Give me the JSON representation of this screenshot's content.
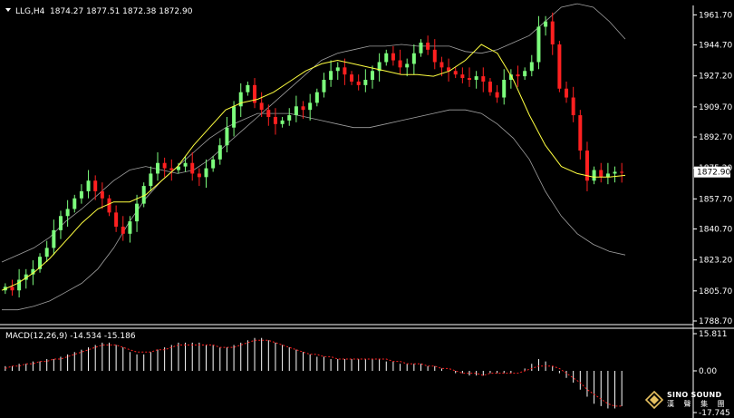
{
  "header": {
    "symbol": "LLG,H4",
    "ohlc": "1874.27 1877.51 1872.38 1872.90"
  },
  "macd_label": "MACD(12,26,9) -14.534 -15.186",
  "price_axis": {
    "ticks": [
      "1961.70",
      "1944.70",
      "1927.20",
      "1909.70",
      "1892.70",
      "1875.20",
      "1857.70",
      "1840.70",
      "1823.20",
      "1805.70",
      "1788.70"
    ],
    "current_price": "1872.90"
  },
  "macd_axis": {
    "ticks": [
      "15.811",
      "0.00",
      "-17.745"
    ]
  },
  "logo": {
    "en": "SINO SOUND",
    "cn": "漢 聲 集 團"
  },
  "colors": {
    "background": "#000000",
    "bull": "#7CFC7C",
    "bear": "#FF2020",
    "ma": "#FFFF40",
    "bands": "#A0A0A0",
    "macd_hist": "#FFFFFF",
    "macd_signal": "#FF2020"
  },
  "chart_data": [
    {
      "type": "candlestick",
      "title": "LLG,H4",
      "ylim": [
        1788.7,
        1966
      ],
      "indicators": [
        "Bollinger Bands",
        "Moving Average"
      ],
      "close_path": [
        1808,
        1806,
        1812,
        1815,
        1818,
        1825,
        1830,
        1840,
        1848,
        1852,
        1858,
        1862,
        1868,
        1862,
        1858,
        1850,
        1842,
        1838,
        1845,
        1855,
        1865,
        1872,
        1878,
        1875,
        1874,
        1876,
        1878,
        1872,
        1870,
        1875,
        1880,
        1888,
        1898,
        1910,
        1918,
        1922,
        1912,
        1908,
        1904,
        1900,
        1902,
        1905,
        1910,
        1908,
        1912,
        1918,
        1925,
        1930,
        1932,
        1928,
        1924,
        1922,
        1925,
        1930,
        1935,
        1940,
        1936,
        1932,
        1934,
        1940,
        1946,
        1942,
        1935,
        1932,
        1930,
        1928,
        1926,
        1925,
        1927,
        1924,
        1918,
        1915,
        1925,
        1928,
        1927,
        1930,
        1935,
        1955,
        1958,
        1945,
        1920,
        1915,
        1905,
        1885,
        1868,
        1874,
        1870,
        1872,
        1873,
        1872.9
      ],
      "bb_upper": [
        1822,
        1826,
        1830,
        1836,
        1845,
        1852,
        1860,
        1868,
        1874,
        1876,
        1874,
        1872,
        1874,
        1880,
        1888,
        1896,
        1904,
        1912,
        1920,
        1928,
        1936,
        1940,
        1942,
        1944,
        1944,
        1945,
        1944,
        1944,
        1944,
        1941,
        1940,
        1942,
        1946,
        1950,
        1958,
        1966,
        1968,
        1966,
        1958,
        1948
      ],
      "bb_lower": [
        1795,
        1795,
        1797,
        1800,
        1805,
        1810,
        1818,
        1830,
        1845,
        1858,
        1868,
        1876,
        1884,
        1892,
        1898,
        1902,
        1906,
        1906,
        1906,
        1904,
        1902,
        1900,
        1898,
        1898,
        1900,
        1902,
        1904,
        1906,
        1908,
        1908,
        1906,
        1900,
        1892,
        1880,
        1862,
        1848,
        1838,
        1832,
        1828,
        1826
      ],
      "moving_average": [
        1806,
        1810,
        1816,
        1824,
        1834,
        1844,
        1852,
        1856,
        1856,
        1860,
        1868,
        1876,
        1888,
        1898,
        1908,
        1912,
        1914,
        1918,
        1924,
        1930,
        1934,
        1936,
        1934,
        1932,
        1930,
        1928,
        1928,
        1927,
        1930,
        1936,
        1945,
        1940,
        1925,
        1905,
        1888,
        1876,
        1872,
        1870,
        1870,
        1871
      ]
    },
    {
      "type": "bar",
      "title": "MACD(12,26,9) -14.534 -15.186",
      "ylim": [
        -17.745,
        15.811
      ],
      "series": [
        {
          "name": "MACD",
          "values": [
            2,
            2,
            3,
            3,
            4,
            4,
            5,
            5,
            6,
            7,
            8,
            9,
            10,
            11,
            12,
            12,
            11,
            10,
            8,
            7,
            7,
            8,
            9,
            10,
            11,
            12,
            12,
            12,
            12,
            11,
            11,
            10,
            10,
            11,
            12,
            13,
            14,
            14,
            13,
            12,
            11,
            10,
            9,
            8,
            7,
            6,
            6,
            5,
            5,
            5,
            5,
            5,
            5,
            5,
            5,
            4,
            4,
            3,
            3,
            3,
            3,
            2,
            2,
            1,
            0,
            -1,
            -1,
            -2,
            -2,
            -2,
            -1,
            -1,
            -1,
            -1,
            0,
            1,
            3,
            5,
            4,
            2,
            -1,
            -3,
            -5,
            -8,
            -11,
            -14,
            -15,
            -16,
            -16,
            -15
          ]
        },
        {
          "name": "Signal",
          "values": [
            1,
            2,
            2,
            3,
            3,
            4,
            4,
            5,
            5,
            6,
            7,
            8,
            9,
            10,
            11,
            11,
            11,
            10,
            9,
            8,
            8,
            8,
            9,
            9,
            10,
            11,
            11,
            11,
            11,
            11,
            11,
            10,
            10,
            10,
            11,
            12,
            13,
            13,
            13,
            12,
            11,
            10,
            9,
            8,
            7,
            7,
            6,
            6,
            5,
            5,
            5,
            5,
            5,
            5,
            5,
            5,
            4,
            4,
            3,
            3,
            3,
            2,
            2,
            1,
            1,
            0,
            -1,
            -1,
            -1,
            -2,
            -1,
            -1,
            -1,
            -1,
            -1,
            0,
            1,
            2,
            2,
            2,
            1,
            -1,
            -3,
            -5,
            -8,
            -10,
            -12,
            -14,
            -15,
            -15
          ]
        }
      ]
    }
  ]
}
